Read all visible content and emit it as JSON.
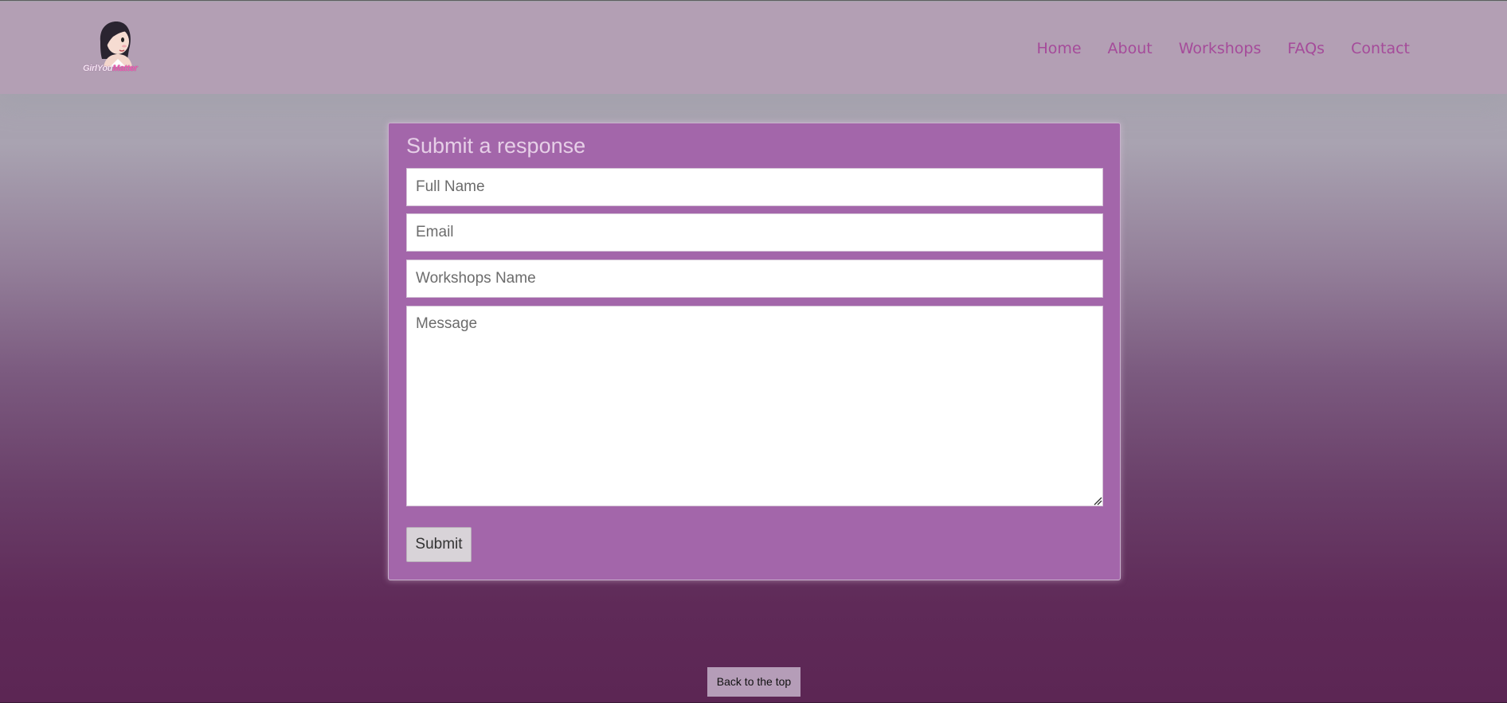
{
  "brand": {
    "logo_text_main": "GirlYou",
    "logo_text_accent": "Matter"
  },
  "nav": {
    "items": [
      "Home",
      "About",
      "Workshops",
      "FAQs",
      "Contact"
    ]
  },
  "form": {
    "title": "Submit a response",
    "full_name_placeholder": "Full Name",
    "email_placeholder": "Email",
    "workshop_placeholder": "Workshops Name",
    "message_placeholder": "Message",
    "submit_label": "Submit"
  },
  "footer": {
    "back_to_top_label": "Back to the top"
  },
  "colors": {
    "header_bg": "#b39fb4",
    "nav_link": "#a54b9a",
    "card_bg": "#a366aa",
    "button_bg": "#d8d3d8",
    "back_top_bg": "#b59db8"
  }
}
